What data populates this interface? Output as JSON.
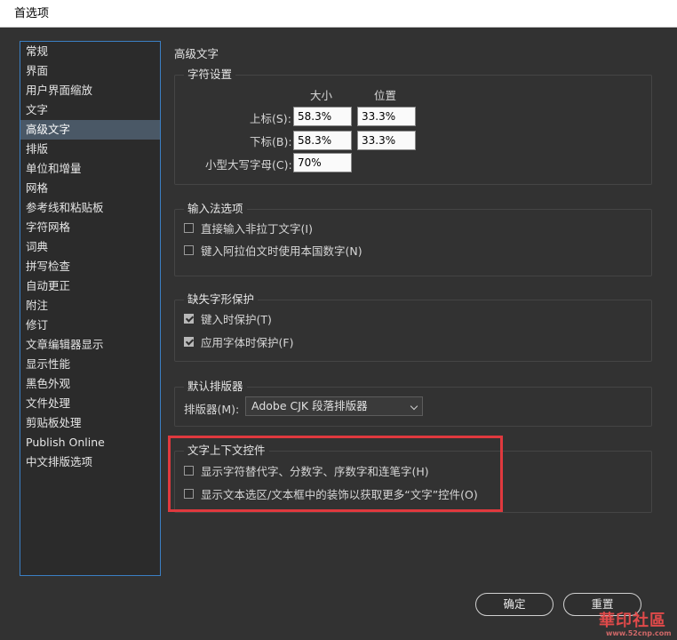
{
  "window": {
    "title": "首选项"
  },
  "sidebar": {
    "items": [
      {
        "label": "常规"
      },
      {
        "label": "界面"
      },
      {
        "label": "用户界面缩放"
      },
      {
        "label": "文字"
      },
      {
        "label": "高级文字",
        "selected": true
      },
      {
        "label": "排版"
      },
      {
        "label": "单位和增量"
      },
      {
        "label": "网格"
      },
      {
        "label": "参考线和粘贴板"
      },
      {
        "label": "字符网格"
      },
      {
        "label": "词典"
      },
      {
        "label": "拼写检查"
      },
      {
        "label": "自动更正"
      },
      {
        "label": "附注"
      },
      {
        "label": "修订"
      },
      {
        "label": "文章编辑器显示"
      },
      {
        "label": "显示性能"
      },
      {
        "label": "黑色外观"
      },
      {
        "label": "文件处理"
      },
      {
        "label": "剪贴板处理"
      },
      {
        "label": "Publish Online"
      },
      {
        "label": "中文排版选项"
      }
    ]
  },
  "main": {
    "title": "高级文字",
    "char_settings": {
      "legend": "字符设置",
      "col_size": "大小",
      "col_position": "位置",
      "superscript": {
        "label": "上标(S):",
        "size": "58.3%",
        "position": "33.3%"
      },
      "subscript": {
        "label": "下标(B):",
        "size": "58.3%",
        "position": "33.3%"
      },
      "small_caps": {
        "label": "小型大写字母(C):",
        "value": "70%"
      }
    },
    "ime": {
      "legend": "输入法选项",
      "direct_input": {
        "label": "直接输入非拉丁文字(I)",
        "checked": false
      },
      "arabic_native_digits": {
        "label": "键入阿拉伯文时使用本国数字(N)",
        "checked": false
      }
    },
    "missing_glyph": {
      "legend": "缺失字形保护",
      "protect_typing": {
        "label": "键入时保护(T)",
        "checked": true
      },
      "protect_font_apply": {
        "label": "应用字体时保护(F)",
        "checked": true
      }
    },
    "composer": {
      "legend": "默认排版器",
      "label": "排版器(M):",
      "selected": "Adobe CJK 段落排版器"
    },
    "contextual_controls": {
      "legend": "文字上下文控件",
      "show_alternates": {
        "label": "显示字符替代字、分数字、序数字和连笔字(H)",
        "checked": false
      },
      "show_adornment": {
        "label": "显示文本选区/文本框中的装饰以获取更多“文字”控件(O)",
        "checked": false
      }
    }
  },
  "footer": {
    "ok_label": "确定",
    "reset_label": "重置"
  },
  "watermark": {
    "text": "華印社區",
    "url": "www.52cnp.com"
  },
  "colors": {
    "highlight": "#e0393e",
    "selection": "#4a5866",
    "sidebar_border": "#3b7fc4"
  }
}
